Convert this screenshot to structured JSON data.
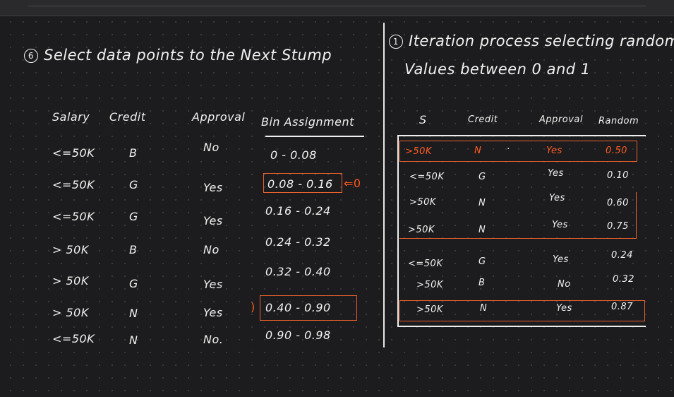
{
  "left": {
    "step_number": "6",
    "title": "Select data points to the Next Stump",
    "headers": [
      "Salary",
      "Credit",
      "Approval",
      "Bin Assignment"
    ],
    "rows": [
      {
        "salary": "<=50K",
        "credit": "B",
        "approval": "No",
        "bin": "0 - 0.08"
      },
      {
        "salary": "<=50K",
        "credit": "G",
        "approval": "Yes",
        "bin": "0.08 - 0.16"
      },
      {
        "salary": "<=50K",
        "credit": "G",
        "approval": "Yes",
        "bin": "0.16 - 0.24"
      },
      {
        "salary": "> 50K",
        "credit": "B",
        "approval": "No",
        "bin": "0.24 - 0.32"
      },
      {
        "salary": "> 50K",
        "credit": "G",
        "approval": "Yes",
        "bin": "0.32 - 0.40"
      },
      {
        "salary": "> 50K",
        "credit": "N",
        "approval": "Yes",
        "bin": "0.40 - 0.90"
      },
      {
        "salary": "<=50K",
        "credit": "N",
        "approval": "No.",
        "bin": "0.90 - 0.98"
      }
    ],
    "arrow_label": "0"
  },
  "right": {
    "step_number": "1",
    "title_line1": "Iteration process selecting random",
    "title_line2": "Values between 0 and 1",
    "headers": [
      "S",
      "Credit",
      "Approval",
      "Random"
    ],
    "rows": [
      {
        "s": ">50K",
        "credit": "N",
        "approval": "Yes",
        "random": "0.50"
      },
      {
        "s": "<=50K",
        "credit": "G",
        "approval": "Yes",
        "random": "0.10"
      },
      {
        "s": ">50K",
        "credit": "N",
        "approval": "Yes",
        "random": "0.60"
      },
      {
        "s": ">50K",
        "credit": "N",
        "approval": "Yes",
        "random": "0.75"
      },
      {
        "s": "<=50K",
        "credit": "G",
        "approval": "Yes",
        "random": "0.24"
      },
      {
        "s": ">50K",
        "credit": "B",
        "approval": "No",
        "random": "0.32"
      },
      {
        "s": ">50K",
        "credit": "N",
        "approval": "Yes",
        "random": "0.87"
      }
    ]
  },
  "colors": {
    "background": "#1c1c1e",
    "ink": "#f0f0f0",
    "highlight": "#e8612c"
  }
}
